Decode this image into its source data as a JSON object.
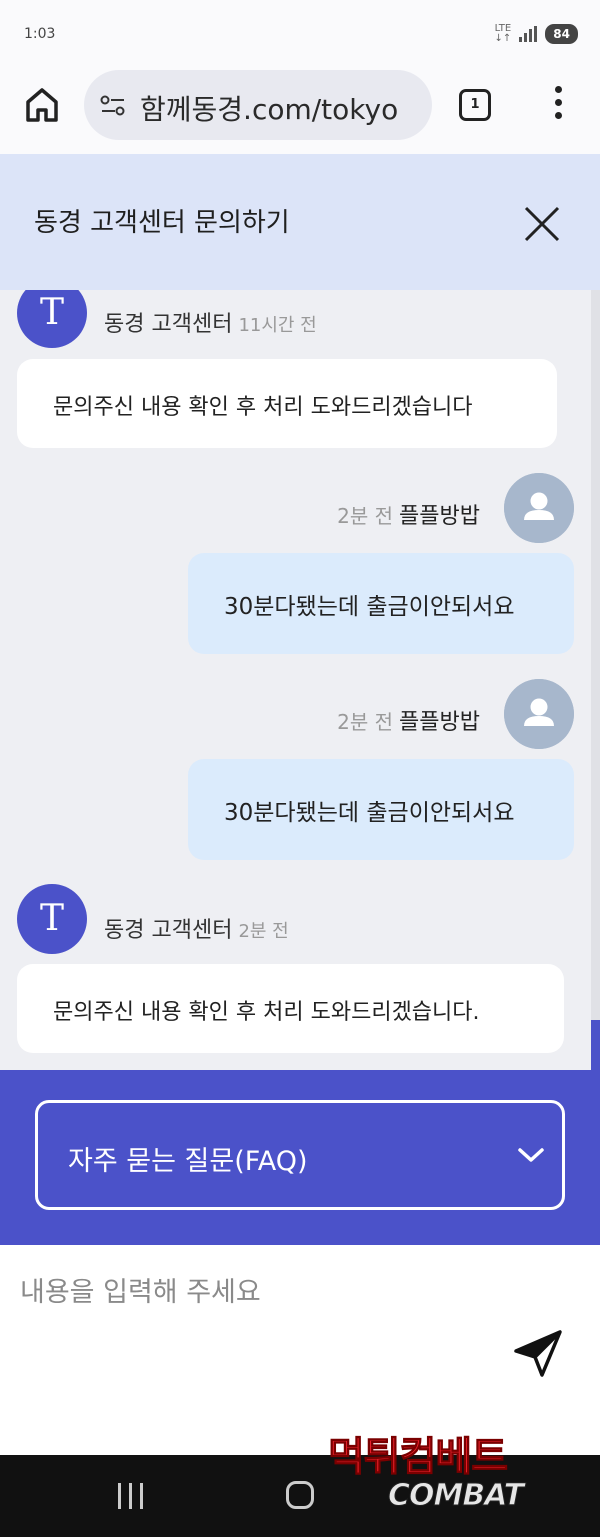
{
  "status": {
    "time": "1:03",
    "network": "LTE",
    "battery": "84"
  },
  "browser": {
    "url": "함께동경.com/tokyo",
    "tab_count": "1"
  },
  "panel": {
    "title": "동경 고객센터 문의하기"
  },
  "messages": [
    {
      "side": "left",
      "avatar": "T",
      "sender": "동경 고객센터",
      "time": "11시간 전",
      "text": "문의주신 내용 확인 후 처리 도와드리겠습니다"
    },
    {
      "side": "right",
      "sender": "플플방밥",
      "time": "2분 전",
      "text": "30분다됐는데 출금이안되서요"
    },
    {
      "side": "right",
      "sender": "플플방밥",
      "time": "2분 전",
      "text": "30분다됐는데 출금이안되서요"
    },
    {
      "side": "left",
      "avatar": "T",
      "sender": "동경 고객센터",
      "time": "2분 전",
      "text": "문의주신 내용 확인 후 처리 도와드리겠습니다."
    }
  ],
  "faq": {
    "label": "자주 묻는 질문(FAQ)"
  },
  "composer": {
    "placeholder": "내용을 입력해 주세요"
  },
  "watermark": {
    "top": "먹튀컴베트",
    "bottom": "COMBAT"
  },
  "colors": {
    "accent": "#4b52c9",
    "header_bg": "#dce4f8",
    "user_bubble": "#dbebfc",
    "page_bg": "#eeeff3"
  }
}
